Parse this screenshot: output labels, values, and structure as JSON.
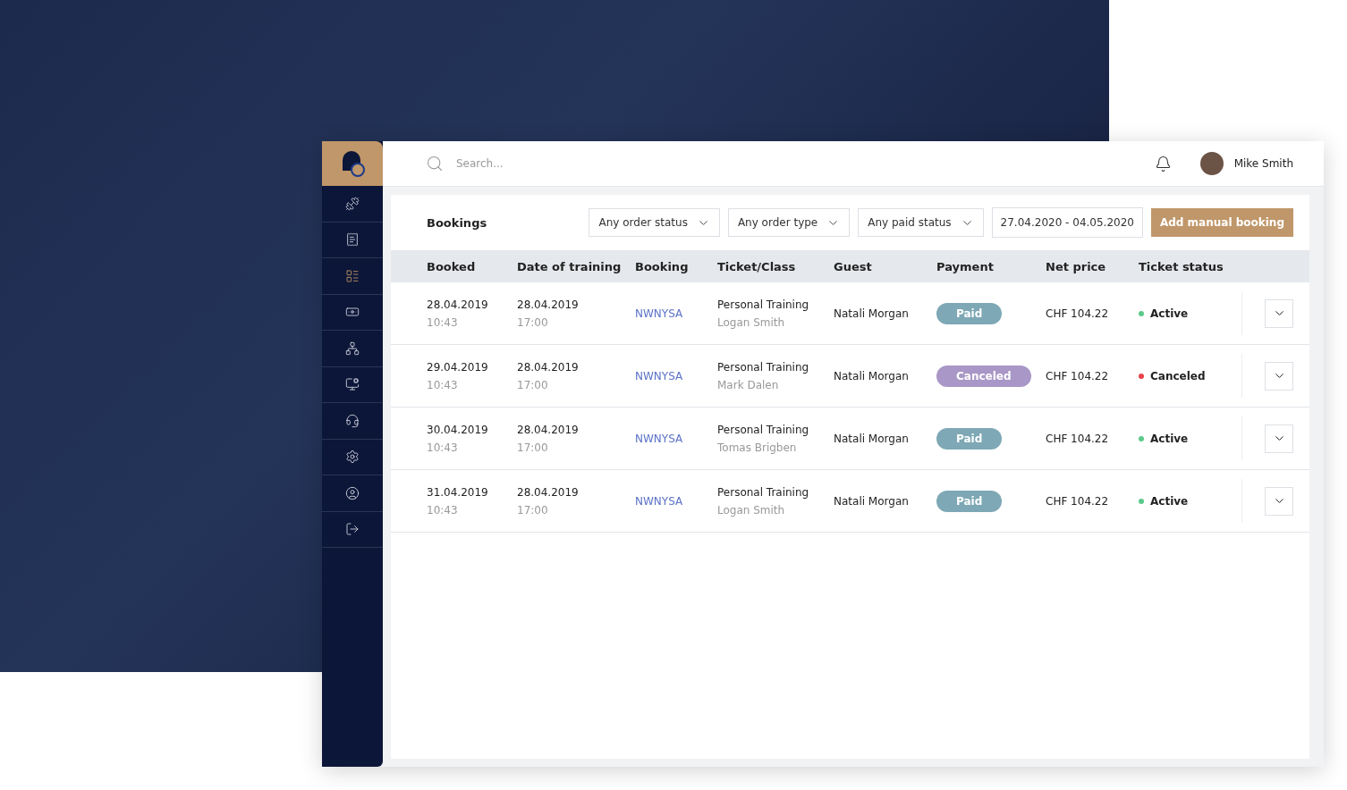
{
  "sidebar": {
    "items": [
      {
        "selected": false
      },
      {
        "selected": false
      },
      {
        "selected": true
      },
      {
        "selected": false
      },
      {
        "selected": false
      },
      {
        "selected": false
      },
      {
        "selected": false
      },
      {
        "selected": false
      },
      {
        "selected": false
      },
      {
        "selected": false
      }
    ]
  },
  "topbar": {
    "search": {
      "placeholder": "Search..."
    },
    "user": {
      "name": "Mike Smith"
    }
  },
  "bookings": {
    "title": "Bookings",
    "filters": [
      "Any order status",
      "Any order type",
      "Any paid status"
    ],
    "date_range": "27.04.2020 - 04.05.2020",
    "add_button": "Add manual booking",
    "columns": [
      "Booked",
      "Date of training",
      "Booking",
      "Ticket/Class",
      "Guest",
      "Payment",
      "Net price",
      "Ticket status"
    ],
    "rows": [
      {
        "booked_date": "28.04.2019",
        "booked_time": "10:43",
        "training_date": "28.04.2019",
        "training_time": "17:00",
        "booking": "NWNYSA",
        "ticket": "Personal Training",
        "trainer": "Logan Smith",
        "guest": "Natali Morgan",
        "payment": {
          "label": "Paid",
          "kind": "paid"
        },
        "net_price": "CHF 104.22",
        "status": {
          "label": "Active",
          "color": "#5cc98a"
        }
      },
      {
        "booked_date": "29.04.2019",
        "booked_time": "10:43",
        "training_date": "28.04.2019",
        "training_time": "17:00",
        "booking": "NWNYSA",
        "ticket": "Personal Training",
        "trainer": "Mark Dalen",
        "guest": "Natali Morgan",
        "payment": {
          "label": "Canceled",
          "kind": "canceled"
        },
        "net_price": "CHF 104.22",
        "status": {
          "label": "Canceled",
          "color": "#e8424a"
        }
      },
      {
        "booked_date": "30.04.2019",
        "booked_time": "10:43",
        "training_date": "28.04.2019",
        "training_time": "17:00",
        "booking": "NWNYSA",
        "ticket": "Personal Training",
        "trainer": "Tomas Brigben",
        "guest": "Natali Morgan",
        "payment": {
          "label": "Paid",
          "kind": "paid"
        },
        "net_price": "CHF 104.22",
        "status": {
          "label": "Active",
          "color": "#5cc98a"
        }
      },
      {
        "booked_date": "31.04.2019",
        "booked_time": "10:43",
        "training_date": "28.04.2019",
        "training_time": "17:00",
        "booking": "NWNYSA",
        "ticket": "Personal Training",
        "trainer": "Logan Smith",
        "guest": "Natali Morgan",
        "payment": {
          "label": "Paid",
          "kind": "paid"
        },
        "net_price": "CHF 104.22",
        "status": {
          "label": "Active",
          "color": "#5cc98a"
        }
      }
    ]
  }
}
